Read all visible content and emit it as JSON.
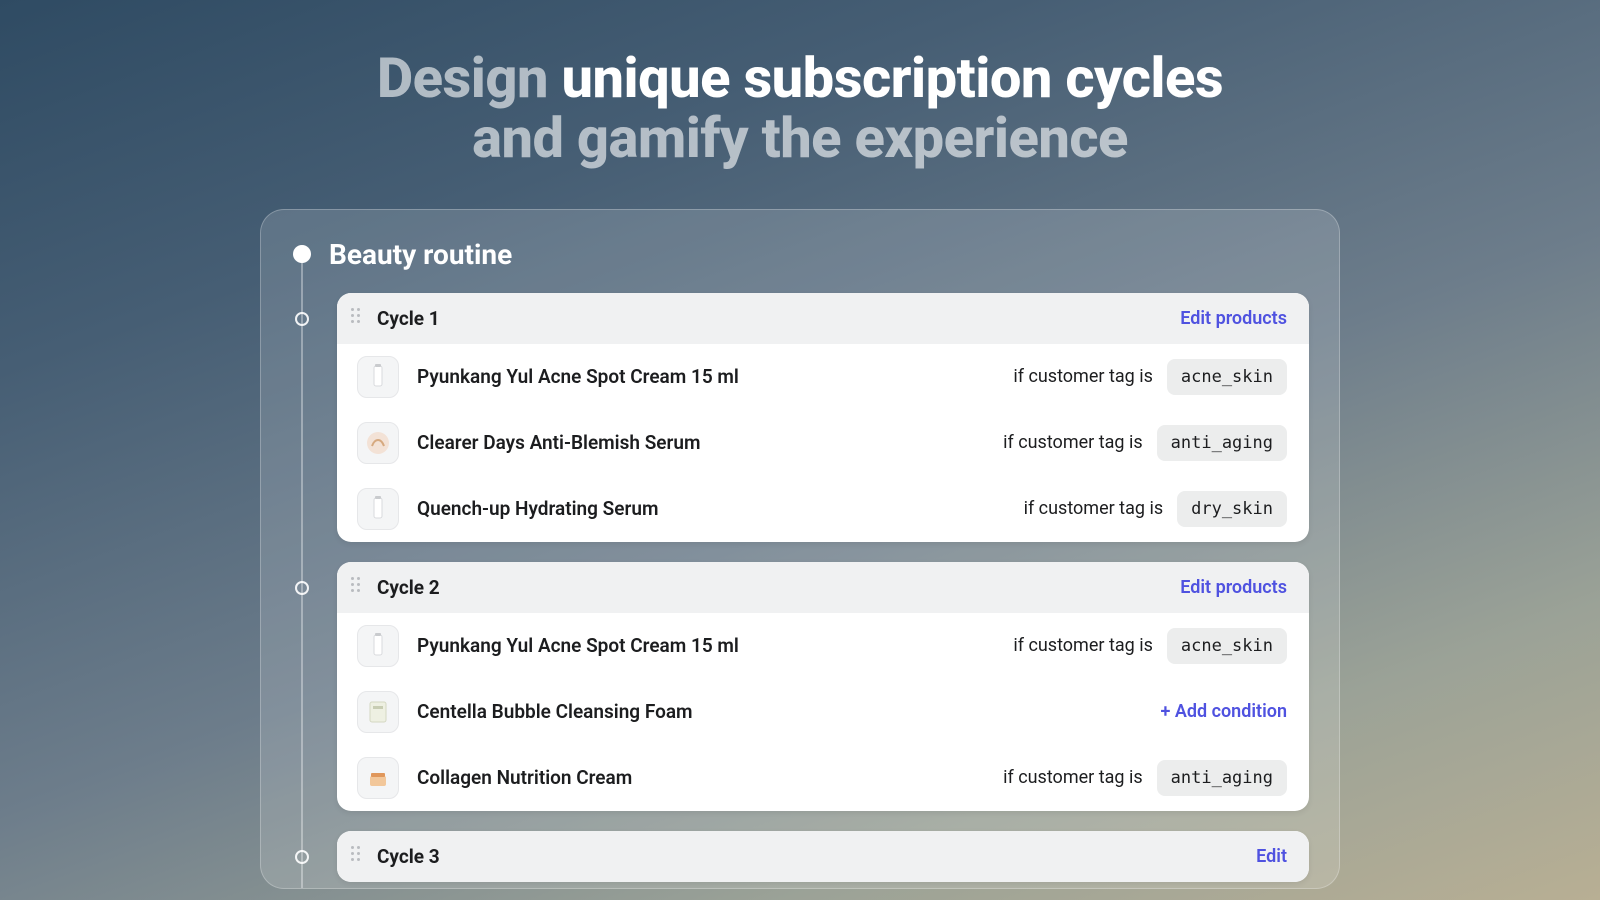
{
  "hero": {
    "prefix": "Design",
    "strong": "unique subscription cycles",
    "line2": "and gamify the experience"
  },
  "routine": {
    "title": "Beauty routine"
  },
  "labels": {
    "edit_products": "Edit products",
    "edit": "Edit",
    "condition_prefix": "if customer tag is",
    "add_condition": "+ Add condition"
  },
  "cycles": [
    {
      "title": "Cycle 1",
      "edit_label_key": "edit_products",
      "products": [
        {
          "name": "Pyunkang Yul Acne Spot Cream 15 ml",
          "tag": "acne_skin",
          "thumb": "tube-white"
        },
        {
          "name": "Clearer Days Anti-Blemish Serum",
          "tag": "anti_aging",
          "thumb": "round-pink"
        },
        {
          "name": "Quench-up Hydrating Serum",
          "tag": "dry_skin",
          "thumb": "tube-white"
        }
      ]
    },
    {
      "title": "Cycle 2",
      "edit_label_key": "edit_products",
      "products": [
        {
          "name": "Pyunkang Yul Acne Spot Cream 15 ml",
          "tag": "acne_skin",
          "thumb": "tube-white"
        },
        {
          "name": "Centella Bubble Cleansing Foam",
          "tag": null,
          "thumb": "box-green"
        },
        {
          "name": "Collagen Nutrition Cream",
          "tag": "anti_aging",
          "thumb": "jar-orange"
        }
      ]
    },
    {
      "title": "Cycle 3",
      "edit_label_key": "edit",
      "products": []
    }
  ]
}
